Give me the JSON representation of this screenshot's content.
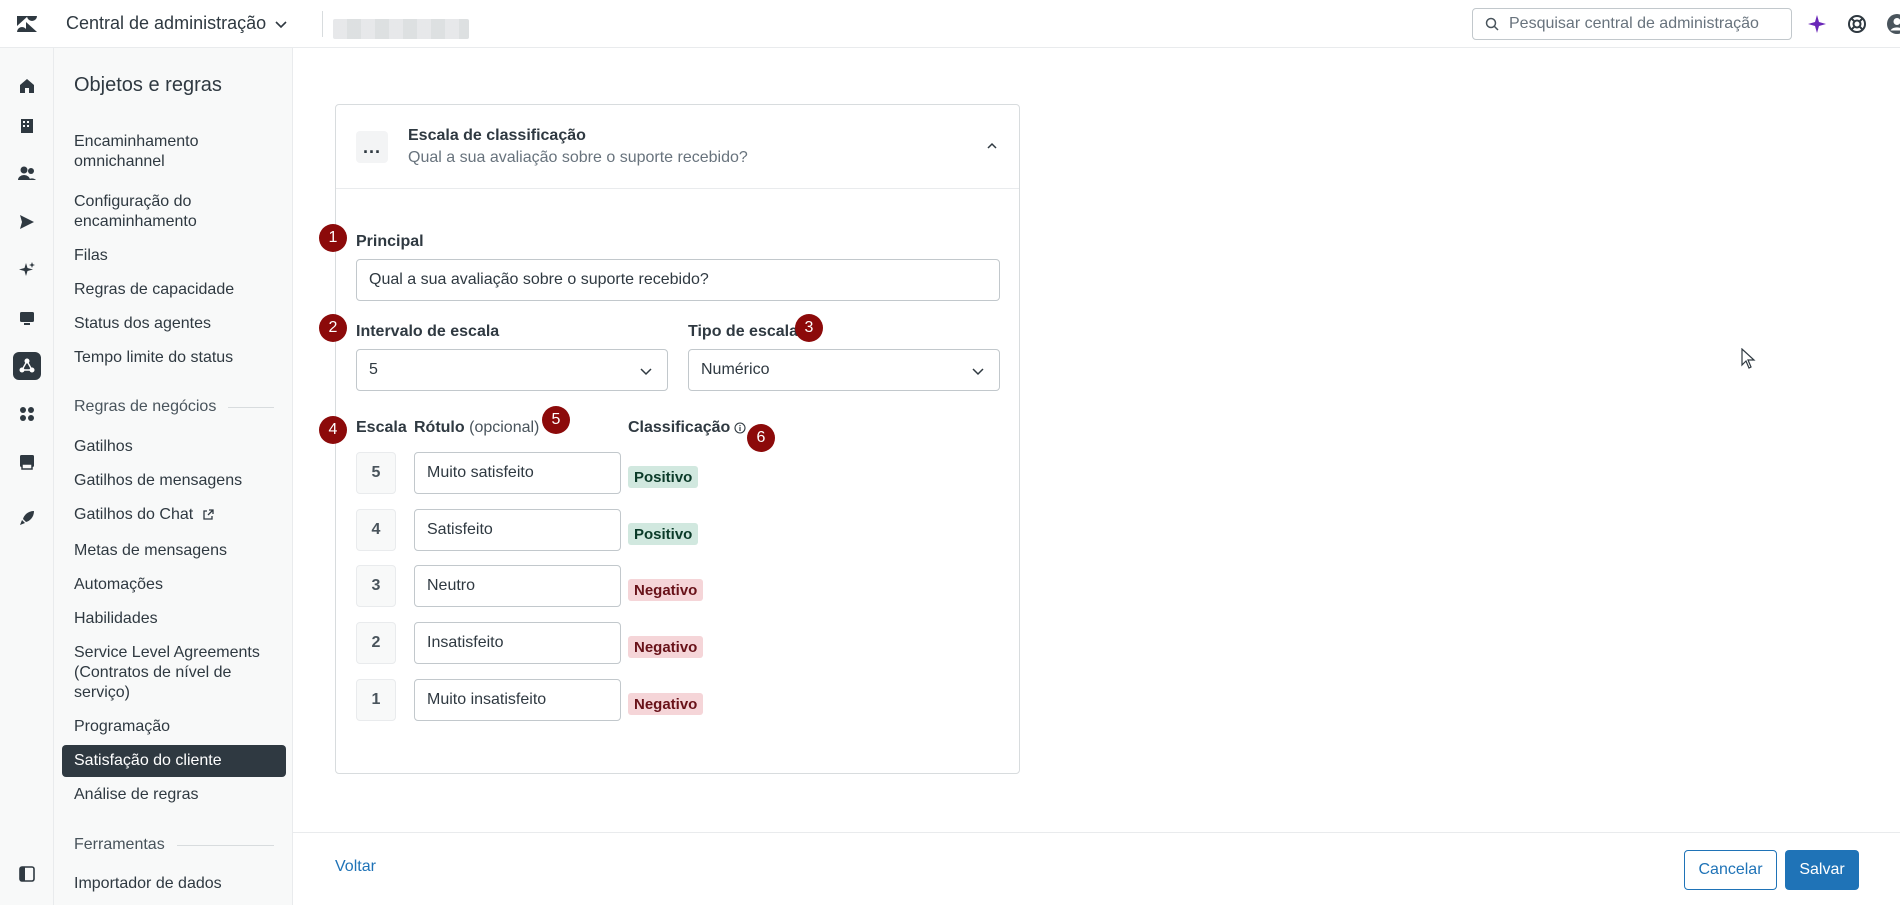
{
  "header": {
    "app_title": "Central de administração",
    "search_placeholder": "Pesquisar central de administração"
  },
  "sidenav": {
    "title": "Objetos e regras",
    "items": [
      {
        "label": "Encaminhamento omnichannel"
      },
      {
        "label": "Configuração do encaminhamento"
      },
      {
        "label": "Filas"
      },
      {
        "label": "Regras de capacidade"
      },
      {
        "label": "Status dos agentes"
      },
      {
        "label": "Tempo limite do status"
      },
      {
        "label": "Gatilhos"
      },
      {
        "label": "Gatilhos de mensagens"
      },
      {
        "label": "Gatilhos do Chat"
      },
      {
        "label": "Metas de mensagens"
      },
      {
        "label": "Automações"
      },
      {
        "label": "Habilidades"
      },
      {
        "label": "Service Level Agreements (Contratos de nível de serviço)"
      },
      {
        "label": "Programação"
      },
      {
        "label": "Satisfação do cliente"
      },
      {
        "label": "Análise de regras"
      },
      {
        "label": "Importador de dados"
      }
    ],
    "sections": {
      "business_rules": "Regras de negócios",
      "tools": "Ferramentas"
    }
  },
  "card": {
    "title": "Escala de classificação",
    "subtitle": "Qual a sua avaliação sobre o suporte recebido?",
    "menu_label": "..."
  },
  "form": {
    "principal_label": "Principal",
    "principal_value": "Qual a sua avaliação sobre o suporte recebido?",
    "interval_label": "Intervalo de escala",
    "interval_value": "5",
    "type_label": "Tipo de escala",
    "type_value": "Numérico",
    "col_scale": "Escala",
    "col_label": "Rótulo",
    "col_label_optional": "(opcional)",
    "col_classification": "Classificação",
    "rows": [
      {
        "scale": "5",
        "label": "Muito satisfeito",
        "classification": "Positivo"
      },
      {
        "scale": "4",
        "label": "Satisfeito",
        "classification": "Positivo"
      },
      {
        "scale": "3",
        "label": "Neutro",
        "classification": "Negativo"
      },
      {
        "scale": "2",
        "label": "Insatisfeito",
        "classification": "Negativo"
      },
      {
        "scale": "1",
        "label": "Muito insatisfeito",
        "classification": "Negativo"
      }
    ]
  },
  "markers": [
    "1",
    "2",
    "3",
    "4",
    "5",
    "6"
  ],
  "footer": {
    "back": "Voltar",
    "cancel": "Cancelar",
    "save": "Salvar"
  },
  "colors": {
    "accent": "#1f73b7",
    "marker": "#8c0a0a",
    "positive_bg": "#d1e8df",
    "negative_bg": "#f5d5d8"
  }
}
